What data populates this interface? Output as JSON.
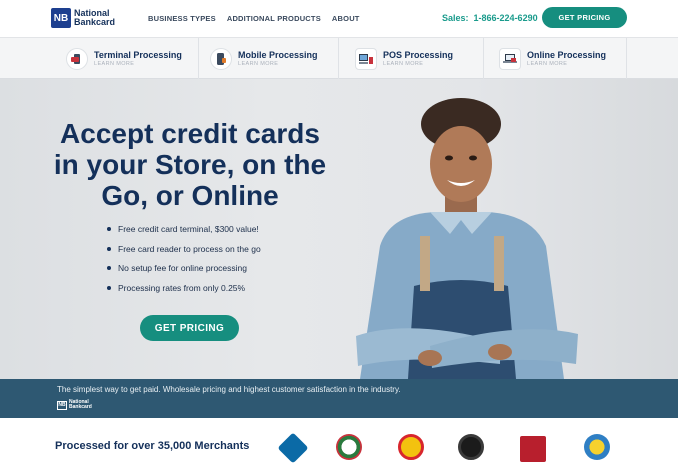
{
  "header": {
    "logo_initials": "NB",
    "logo_line1": "National",
    "logo_line2": "Bankcard",
    "nav": [
      "BUSINESS TYPES",
      "ADDITIONAL PRODUCTS",
      "ABOUT"
    ],
    "sales_label": "Sales:",
    "sales_phone": "1-866-224-6290",
    "cta": "GET PRICING"
  },
  "services": [
    {
      "title": "Terminal Processing",
      "sub": "LEARN MORE",
      "icon": "card-terminal-icon"
    },
    {
      "title": "Mobile Processing",
      "sub": "LEARN MORE",
      "icon": "mobile-reader-icon"
    },
    {
      "title": "POS Processing",
      "sub": "LEARN MORE",
      "icon": "pos-register-icon"
    },
    {
      "title": "Online Processing",
      "sub": "LEARN MORE",
      "icon": "laptop-icon"
    }
  ],
  "hero": {
    "title_line1": "Accept credit cards",
    "title_line2": "in your Store, on the",
    "title_line3": "Go, or Online",
    "bullets": [
      "Free credit card terminal, $300 value!",
      "Free card reader to process on the go",
      "No setup fee for online processing",
      "Processing rates from only 0.25%"
    ],
    "cta": "GET PRICING"
  },
  "band": {
    "text": "The simplest way to get paid. Wholesale pricing and highest customer satisfaction in the industry.",
    "logo_initials": "NB",
    "logo_line1": "National",
    "logo_line2": "Bankcard"
  },
  "merchants": {
    "text": "Processed for over 35,000 Merchants",
    "brand_icons": [
      "dominos-logo-icon",
      "brand-logo-icon",
      "shell-logo-icon",
      "bmw-logo-icon",
      "kfc-logo-icon",
      "brand-logo-icon"
    ]
  },
  "colors": {
    "navy": "#14305a",
    "teal": "#168e7f",
    "band": "#2e5872"
  }
}
